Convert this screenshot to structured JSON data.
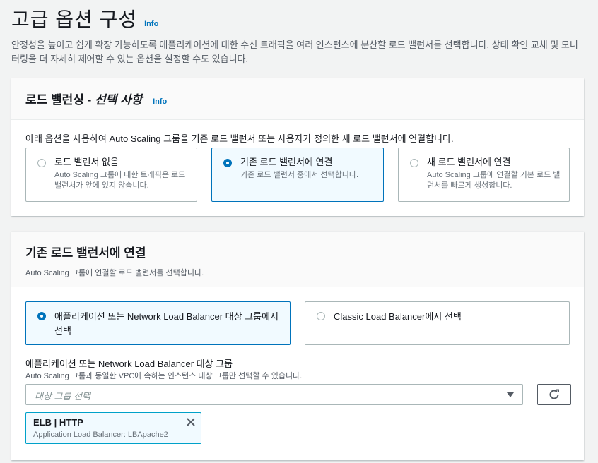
{
  "page": {
    "title": "고급 옵션 구성",
    "info": "Info",
    "description": "안정성을 높이고 쉽게 확장 가능하도록 애플리케이션에 대한 수신 트래픽을 여러 인스턴스에 분산할 로드 밸런서를 선택합니다. 상태 확인 교체 및 모니터링을 더 자세히 제어할 수 있는 옵션을 설정할 수도 있습니다."
  },
  "load_balancing": {
    "title": "로드 밸런싱 - ",
    "title_optional": "선택 사항",
    "info": "Info",
    "instruction": "아래 옵션을 사용하여 Auto Scaling 그룹을 기존 로드 밸런서 또는 사용자가 정의한 새 로드 밸런서에 연결합니다.",
    "options": [
      {
        "label": "로드 밸런서 없음",
        "description": "Auto Scaling 그룹에 대한 트래픽은 로드 밸런서가 앞에 있지 않습니다.",
        "selected": false
      },
      {
        "label": "기존 로드 밸런서에 연결",
        "description": "기존 로드 밸런서 중에서 선택합니다.",
        "selected": true
      },
      {
        "label": "새 로드 밸런서에 연결",
        "description": "Auto Scaling 그룹에 연결할 기본 로드 밸런서를 빠르게 생성합니다.",
        "selected": false
      }
    ]
  },
  "attach_existing": {
    "title": "기존 로드 밸런서에 연결",
    "description": "Auto Scaling 그룹에 연결할 로드 밸런서를 선택합니다.",
    "choices": [
      {
        "label": "애플리케이션 또는 Network Load Balancer 대상 그룹에서 선택",
        "selected": true
      },
      {
        "label": "Classic Load Balancer에서 선택",
        "selected": false
      }
    ],
    "target_group": {
      "label": "애플리케이션 또는 Network Load Balancer 대상 그룹",
      "description": "Auto Scaling 그룹과 동일한 VPC에 속하는 인스턴스 대상 그룹만 선택할 수 있습니다.",
      "placeholder": "대상 그룹 선택"
    },
    "selected_token": {
      "title": "ELB | HTTP",
      "subtitle": "Application Load Balancer: LBApache2"
    }
  },
  "colors": {
    "accent": "#0073bb",
    "background": "#f2f3f3",
    "border": "#aab7b8",
    "token_border": "#00a1c9"
  },
  "icons": [
    "refresh-icon",
    "close-icon",
    "caret-down-icon"
  ]
}
